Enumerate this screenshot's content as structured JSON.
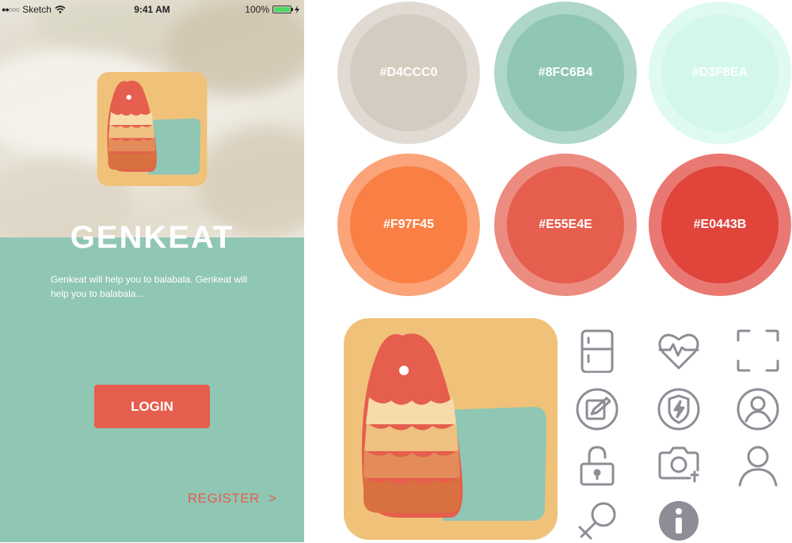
{
  "status_bar": {
    "carrier": "Sketch",
    "time": "9:41 AM",
    "battery": "100%"
  },
  "app": {
    "name": "GENKEAT",
    "description": "Genkeat will help you to balabala. Genkeat will help you to balabala...",
    "login_label": "LOGIN",
    "register_label": "REGISTER",
    "register_chevron": ">"
  },
  "palette": [
    {
      "hex": "#D4CCC0",
      "label": "#D4CCC0"
    },
    {
      "hex": "#8FC6B4",
      "label": "#8FC6B4"
    },
    {
      "hex": "#D3F8EA",
      "label": "#D3F8EA"
    },
    {
      "hex": "#F97F45",
      "label": "#F97F45"
    },
    {
      "hex": "#E55E4E",
      "label": "#E55E4E"
    },
    {
      "hex": "#E0443B",
      "label": "#E0443B"
    }
  ],
  "icons": [
    "fridge-icon",
    "heart-pulse-icon",
    "scan-frame-icon",
    "edit-icon",
    "shield-bolt-icon",
    "user-circle-icon",
    "unlock-icon",
    "camera-add-icon",
    "user-icon",
    "gender-icon",
    "info-icon"
  ]
}
